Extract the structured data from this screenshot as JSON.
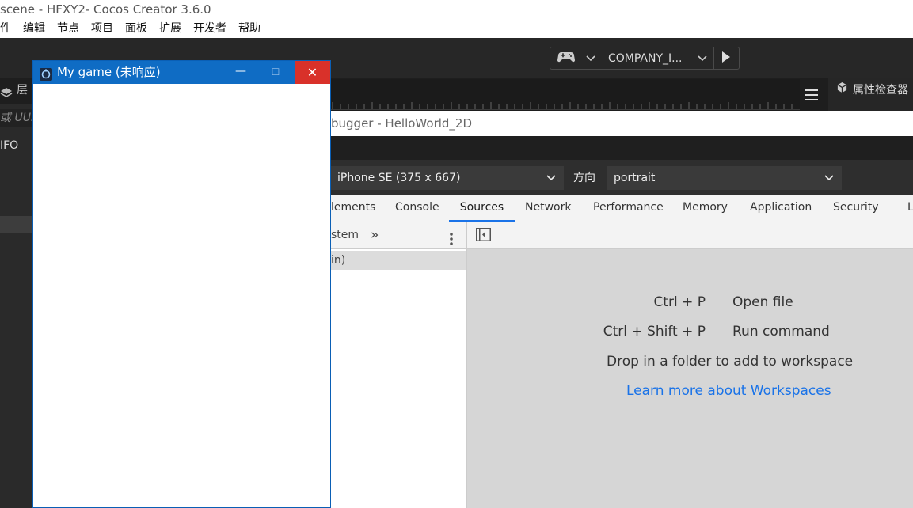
{
  "cocos": {
    "title": "scene - HFXY2- Cocos Creator 3.6.0",
    "menu": [
      "件",
      "编辑",
      "节点",
      "项目",
      "面板",
      "扩展",
      "开发者",
      "帮助"
    ],
    "toolbar": {
      "company": "COMPANY_I..."
    },
    "hierarchy_tab": "层级",
    "inspector_tab": "属性检查器",
    "search_placeholder": "或 UUI",
    "info_text": "IFO"
  },
  "devtools": {
    "title": "bugger - HelloWorld_2D",
    "device": "iPhone SE (375 x 667)",
    "orientation_label": "方向",
    "orientation": "portrait",
    "tabs": [
      "lements",
      "Console",
      "Sources",
      "Network",
      "Performance",
      "Memory",
      "Application",
      "Security",
      "L"
    ],
    "active_tab": "Sources",
    "navigator": {
      "tab": "stem",
      "more": "»",
      "row": "in)"
    },
    "hints": {
      "open_shortcut": "Ctrl + P",
      "open_label": "Open file",
      "run_shortcut": "Ctrl + Shift + P",
      "run_label": "Run command",
      "drop_text": "Drop in a folder to add to workspace",
      "learn_link": "Learn more about Workspaces"
    }
  },
  "game_window": {
    "title": "My game (未响应)"
  }
}
